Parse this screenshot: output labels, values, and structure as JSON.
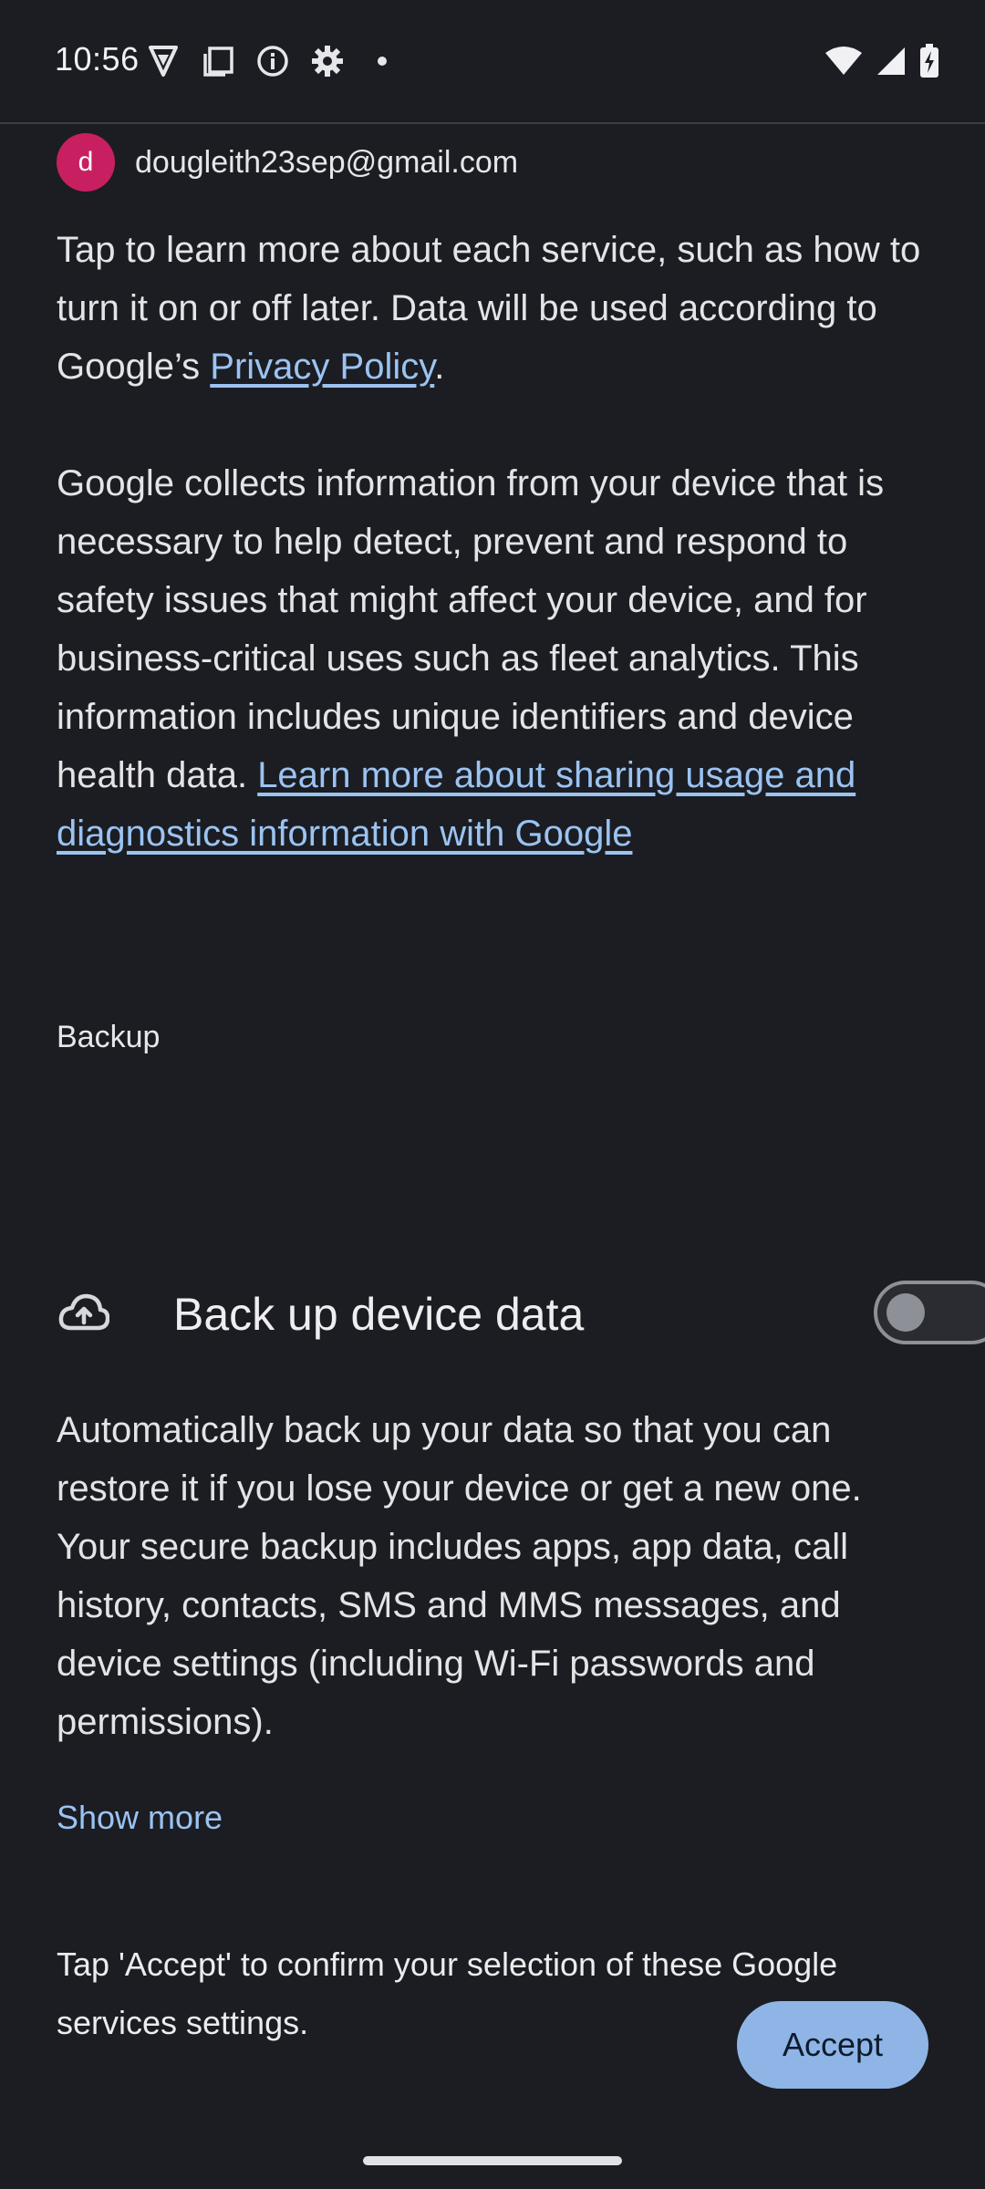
{
  "status_bar": {
    "time": "10:56",
    "left_icons": [
      "vpn-shield-icon",
      "screenshot-icon",
      "info-icon",
      "settings-gear-icon",
      "notification-dot-icon"
    ],
    "right_icons": [
      "wifi-icon",
      "cell-signal-icon",
      "battery-charging-icon"
    ]
  },
  "account": {
    "avatar_letter": "d",
    "email": "dougleith23sep@gmail.com",
    "avatar_color": "#c81f61"
  },
  "intro": {
    "text_before_link": "Tap to learn more about each service, such as how to turn it on or off later. Data will be used according to Google’s ",
    "privacy_link": "Privacy Policy",
    "text_after_link": "."
  },
  "diagnostics": {
    "text": "Google collects information from your device that is necessary to help detect, prevent and respond to safety issues that might affect your device, and for business-critical uses such as fleet analytics. This information includes unique identifiers and device health data. ",
    "learn_more_link": "Learn more about sharing usage and diagnostics information with Google"
  },
  "backup": {
    "section_title": "Backup",
    "toggle_label": "Back up device data",
    "toggle_on": false,
    "description": "Automatically back up your data so that you can restore it if you lose your device or get a new one. Your secure backup includes apps, app data, call history, contacts, SMS and MMS messages, and device settings (including Wi-Fi passwords and permissions).",
    "show_more": "Show more"
  },
  "confirm": {
    "text": "Tap 'Accept' to confirm your selection of these Google services settings."
  },
  "actions": {
    "accept_label": "Accept"
  },
  "colors": {
    "background": "#1b1d22",
    "link": "#9bc3f2",
    "accept_button": "#8fb5e6"
  }
}
